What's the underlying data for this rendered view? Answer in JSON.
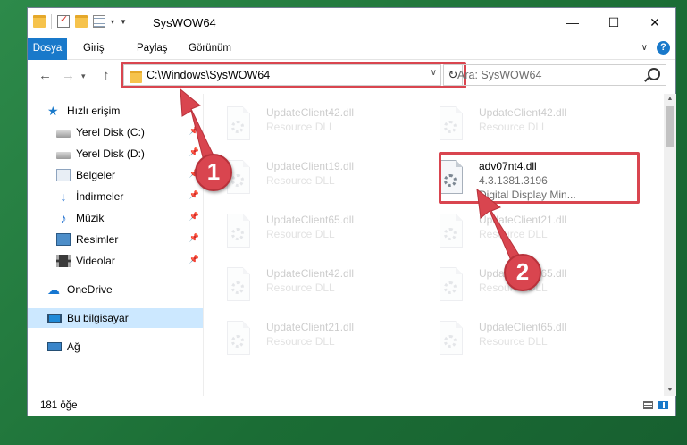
{
  "window": {
    "title": "SysWOW64",
    "controls": {
      "minimize": "—",
      "maximize": "☐",
      "close": "✕"
    }
  },
  "ribbon": {
    "tabs": [
      "Dosya",
      "Giriş",
      "Paylaş",
      "Görünüm"
    ]
  },
  "address": {
    "path": "C:\\Windows\\SysWOW64",
    "search_placeholder": "Ara: SysWOW64"
  },
  "sidebar": {
    "items": [
      {
        "label": "Hızlı erişim",
        "icon": "star-icon",
        "pinned": false
      },
      {
        "label": "Yerel Disk (C:)",
        "icon": "disk-icon",
        "pinned": true
      },
      {
        "label": "Yerel Disk (D:)",
        "icon": "disk-icon",
        "pinned": true
      },
      {
        "label": "Belgeler",
        "icon": "documents-icon",
        "pinned": true
      },
      {
        "label": "İndirmeler",
        "icon": "download-icon",
        "pinned": true
      },
      {
        "label": "Müzik",
        "icon": "music-icon",
        "pinned": true
      },
      {
        "label": "Resimler",
        "icon": "pictures-icon",
        "pinned": true
      },
      {
        "label": "Videolar",
        "icon": "videos-icon",
        "pinned": true
      },
      {
        "label": "OneDrive",
        "icon": "cloud-icon",
        "pinned": false
      },
      {
        "label": "Bu bilgisayar",
        "icon": "computer-icon",
        "pinned": false,
        "selected": true
      },
      {
        "label": "Ağ",
        "icon": "network-icon",
        "pinned": false
      }
    ]
  },
  "files": {
    "highlighted": {
      "name": "adv07nt4.dll",
      "version": "4.3.1381.3196",
      "description": "Digital Display Min..."
    },
    "faded": [
      {
        "name": "UpdateClient42.dll",
        "type": "Resource DLL"
      },
      {
        "name": "UpdateClient42.dll",
        "type": "Resource DLL"
      },
      {
        "name": "UpdateClient19.dll",
        "type": "Resource DLL"
      },
      {
        "name": "UpdateClient65.dll",
        "type": "Resource DLL"
      },
      {
        "name": "UpdateClient21.dll",
        "type": "Resource DLL"
      },
      {
        "name": "UpdateClient42.dll",
        "type": "Resource DLL"
      },
      {
        "name": "UpdateClient65.dll",
        "type": "Resource DLL"
      },
      {
        "name": "UpdateClient21.dll",
        "type": "Resource DLL"
      },
      {
        "name": "UpdateClient65.dll",
        "type": "Resource DLL"
      }
    ]
  },
  "status": {
    "item_count": "181 öğe"
  },
  "annotations": {
    "step1": "1",
    "step2": "2",
    "color": "#d9454f"
  }
}
